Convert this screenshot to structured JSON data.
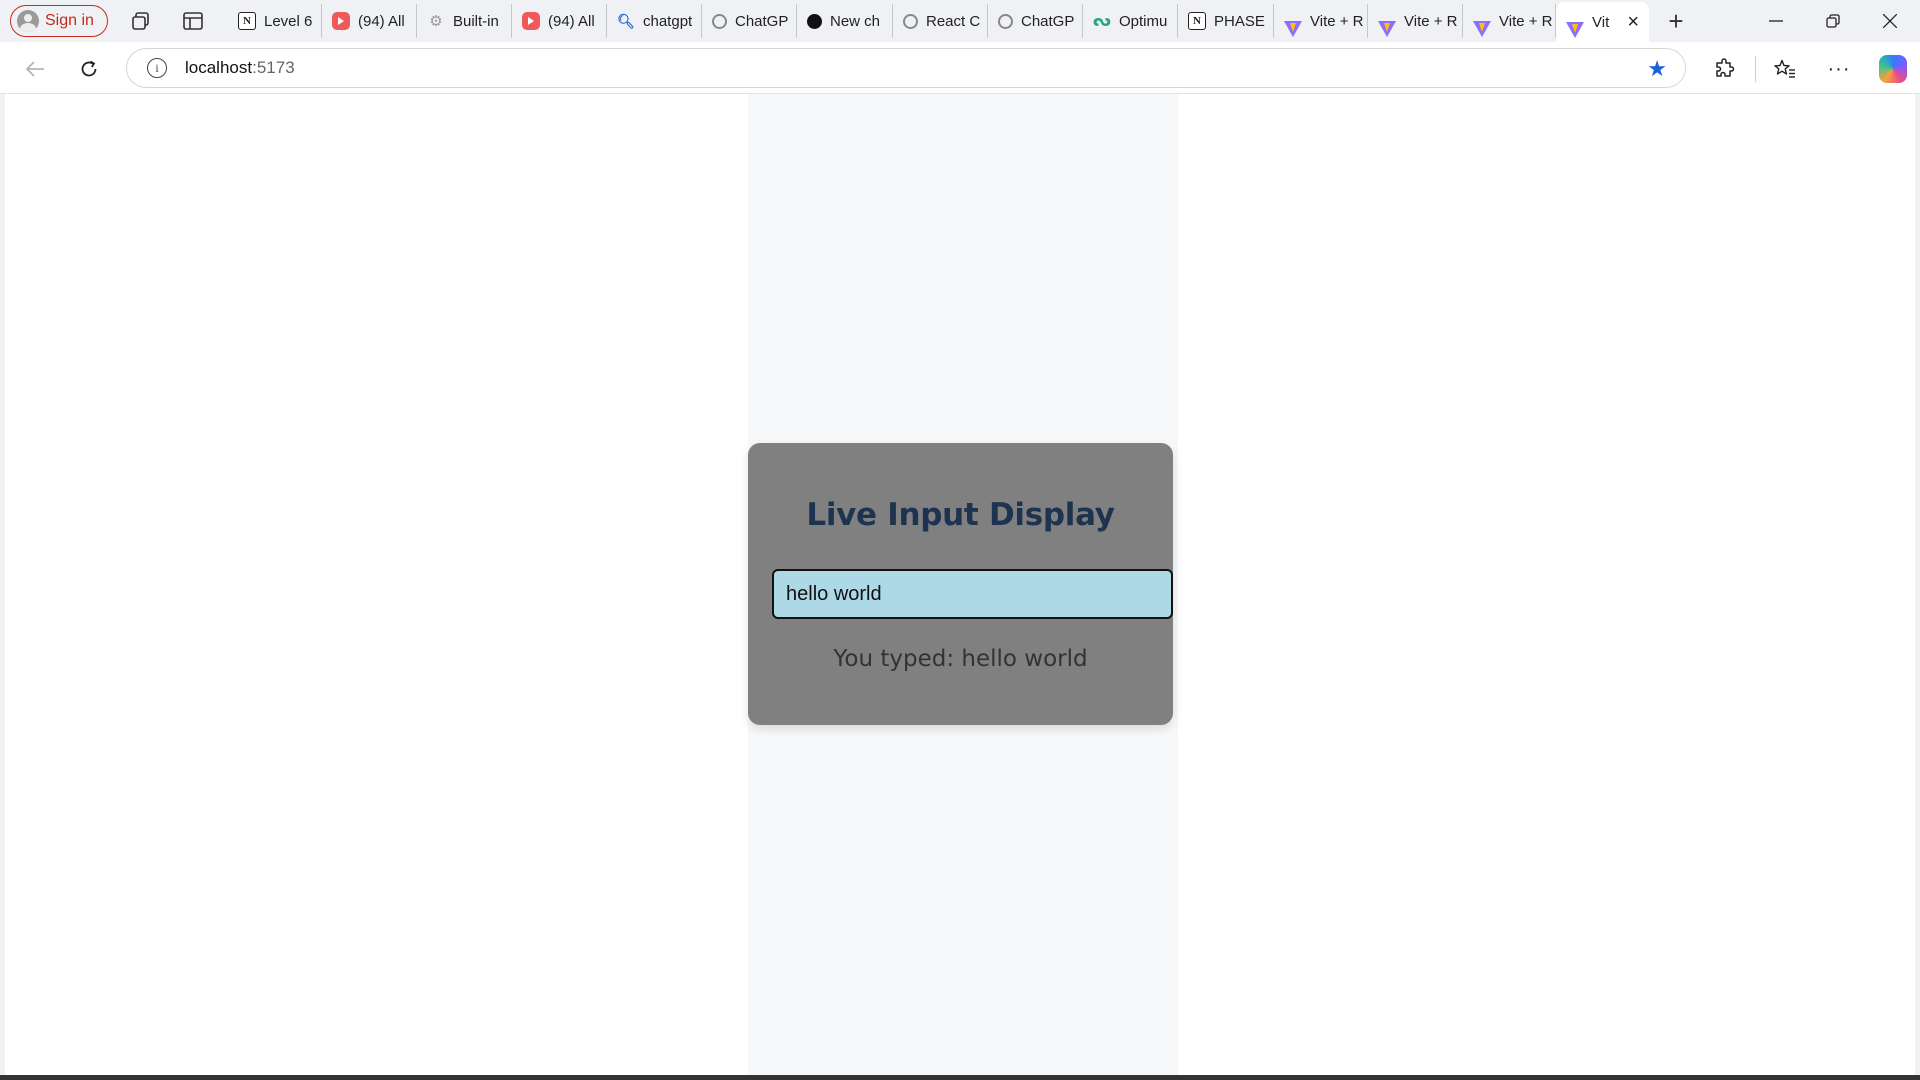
{
  "browser": {
    "signin_label": "Sign in",
    "tabs": [
      {
        "label": "Level 6",
        "icon": "notion-icon"
      },
      {
        "label": "(94) All",
        "icon": "youtube-icon"
      },
      {
        "label": "Built-in",
        "icon": "gear-icon"
      },
      {
        "label": "(94) All",
        "icon": "youtube-icon"
      },
      {
        "label": "chatgpt",
        "icon": "search-icon"
      },
      {
        "label": "ChatGP",
        "icon": "openai-icon"
      },
      {
        "label": "New ch",
        "icon": "openai-icon"
      },
      {
        "label": "React C",
        "icon": "openai-icon"
      },
      {
        "label": "ChatGP",
        "icon": "openai-icon"
      },
      {
        "label": "Optimu",
        "icon": "optimus-icon"
      },
      {
        "label": "PHASE",
        "icon": "notion-icon"
      },
      {
        "label": "Vite + R",
        "icon": "vite-icon"
      },
      {
        "label": "Vite + R",
        "icon": "vite-icon"
      },
      {
        "label": "Vite + R",
        "icon": "vite-icon"
      },
      {
        "label": "Vit",
        "icon": "vite-icon",
        "active": true
      }
    ],
    "address": {
      "host": "localhost",
      "port": ":5173"
    }
  },
  "page": {
    "title": "Live Input Display",
    "input_value": "hello world",
    "output_text": "You typed: hello world"
  },
  "colors": {
    "card_bg": "#808080",
    "input_bg": "#add8e6",
    "title_color": "#1e3350",
    "column_bg": "#f7f8fa"
  }
}
